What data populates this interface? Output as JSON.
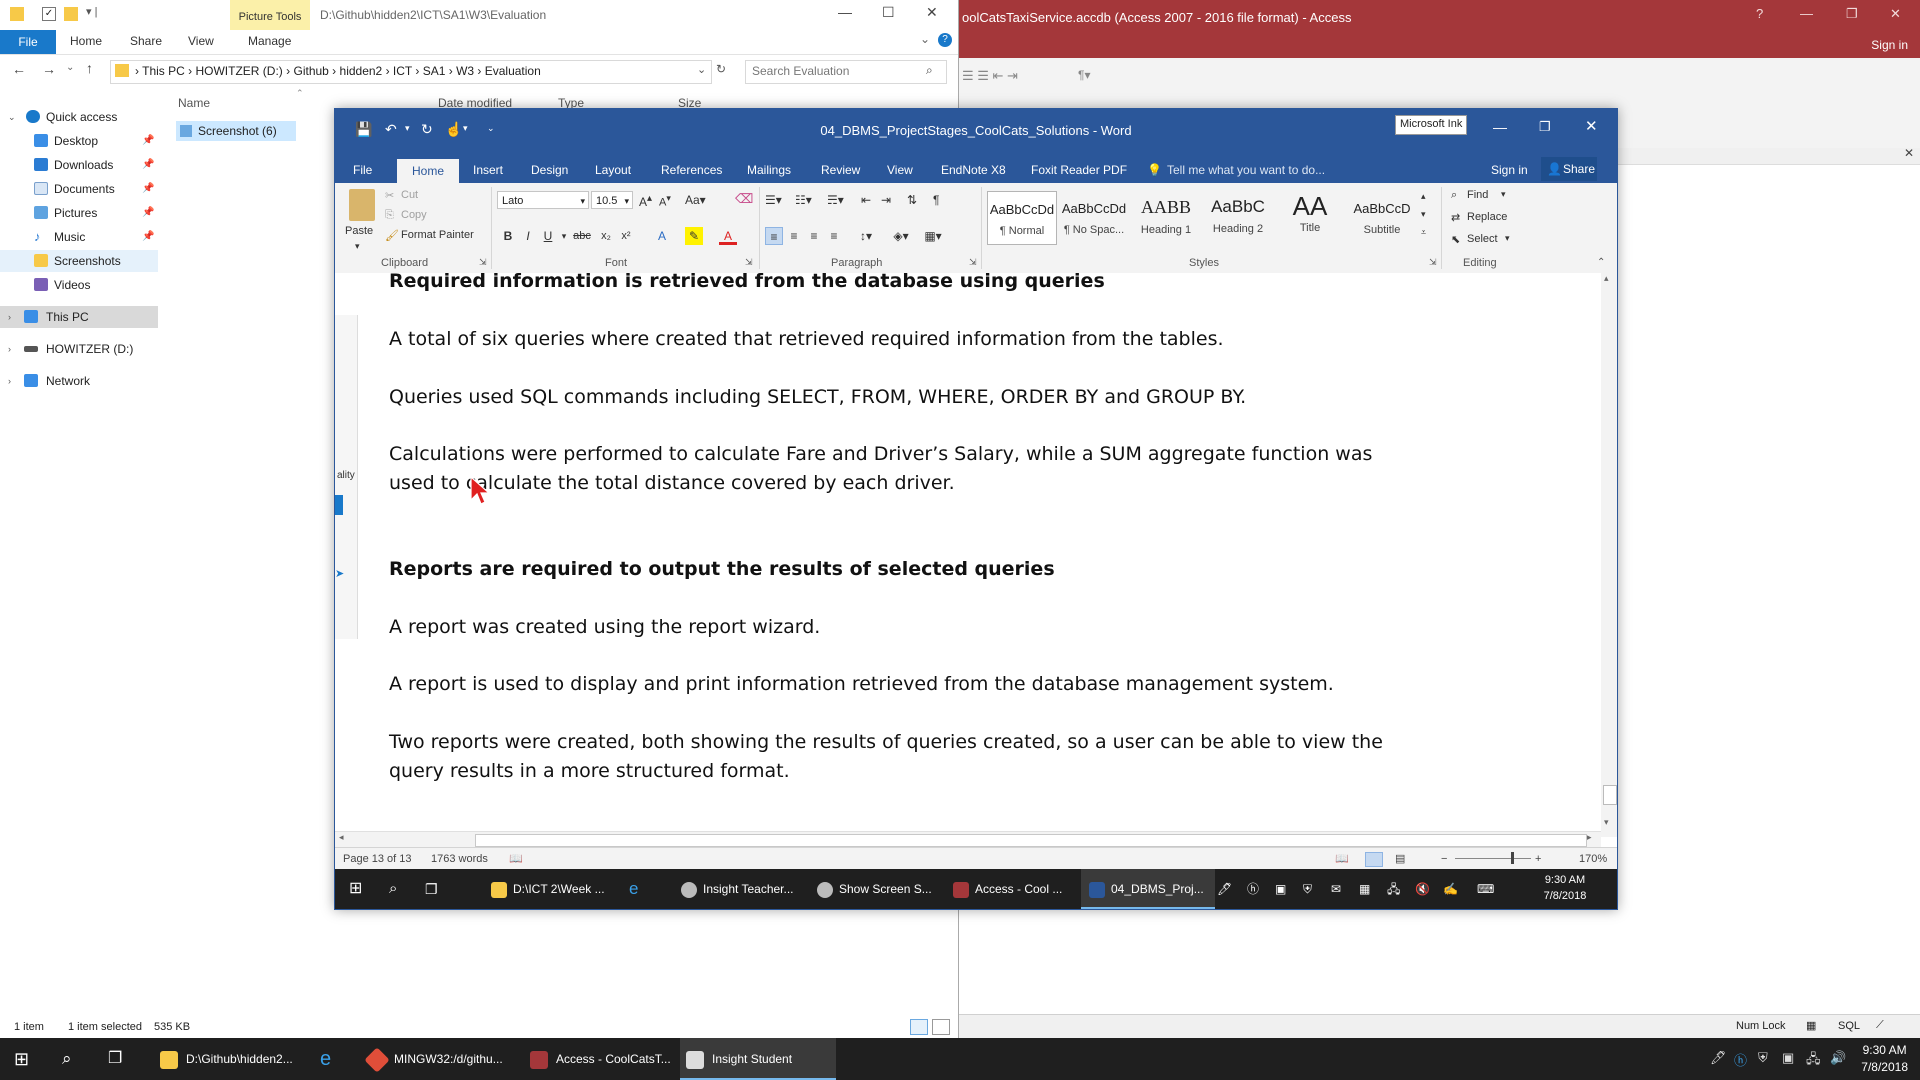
{
  "access": {
    "title": "oolCatsTaxiService.accdb (Access 2007 - 2016 file format) - Access",
    "sign_in": "Sign in",
    "status_numlock": "Num Lock",
    "status_sql": "SQL",
    "help": "?"
  },
  "explorer": {
    "picture_tools": "Picture Tools",
    "path_title": "D:\\Github\\hidden2\\ICT\\SA1\\W3\\Evaluation",
    "tabs": {
      "file": "File",
      "home": "Home",
      "share": "Share",
      "view": "View",
      "manage": "Manage"
    },
    "breadcrumb": [
      "This PC",
      "HOWITZER (D:)",
      "Github",
      "hidden2",
      "ICT",
      "SA1",
      "W3",
      "Evaluation"
    ],
    "search_placeholder": "Search Evaluation",
    "columns": {
      "name": "Name",
      "date": "Date modified",
      "type": "Type",
      "size": "Size"
    },
    "nav": {
      "quick_access": "Quick access",
      "desktop": "Desktop",
      "downloads": "Downloads",
      "documents": "Documents",
      "pictures": "Pictures",
      "music": "Music",
      "screenshots": "Screenshots",
      "videos": "Videos",
      "this_pc": "This PC",
      "howitzer": "HOWITZER (D:)",
      "network": "Network"
    },
    "file_row": "Screenshot (6)",
    "status": {
      "count": "1 item",
      "selected": "1 item selected",
      "size": "535 KB"
    }
  },
  "word": {
    "title": "04_DBMS_ProjectStages_CoolCats_Solutions - Word",
    "ink_tooltip": "Microsoft Ink",
    "tabs": {
      "file": "File",
      "home": "Home",
      "insert": "Insert",
      "design": "Design",
      "layout": "Layout",
      "references": "References",
      "mailings": "Mailings",
      "review": "Review",
      "view": "View",
      "endnote": "EndNote X8",
      "foxit": "Foxit Reader PDF",
      "tell_me": "Tell me what you want to do...",
      "sign_in": "Sign in",
      "share": "Share"
    },
    "ribbon": {
      "paste": "Paste",
      "cut": "Cut",
      "copy": "Copy",
      "format_painter": "Format Painter",
      "font_name": "Lato",
      "font_size": "10.5",
      "clipboard": "Clipboard",
      "font": "Font",
      "paragraph": "Paragraph",
      "styles": "Styles",
      "editing": "Editing",
      "find": "Find",
      "replace": "Replace",
      "select": "Select",
      "style_items": [
        {
          "preview": "AaBbCcDd",
          "name": "¶ Normal"
        },
        {
          "preview": "AaBbCcDd",
          "name": "¶ No Spac..."
        },
        {
          "preview": "AABB",
          "name": "Heading 1"
        },
        {
          "preview": "AaBbC",
          "name": "Heading 2"
        },
        {
          "preview": "AA",
          "name": "Title"
        },
        {
          "preview": "AaBbCcD",
          "name": "Subtitle"
        }
      ]
    },
    "document": {
      "p1": "Required information is retrieved from the database using queries",
      "p2": "A total of six queries where created that retrieved required information from the tables.",
      "p3": "Queries used SQL commands including SELECT, FROM, WHERE, ORDER BY and GROUP BY.",
      "p4": "Calculations were performed to calculate Fare and Driver’s Salary, while a SUM aggregate function was used to calculate the total distance covered by each driver.",
      "p5": "Reports are required to output the results of selected queries",
      "p6": "A report was created using the report wizard.",
      "p7": "A report is used to display and print information retrieved from the database management system.",
      "p8": "Two reports were created, both showing the results of queries created, so a user can be able to view the query results in a more structured format."
    },
    "left_clip_text": "ality",
    "status": {
      "page": "Page 13 of 13",
      "words": "1763 words",
      "zoom": "170%"
    },
    "inner_taskbar": {
      "items": [
        "D:\\ICT 2\\Week ...",
        "Insight Teacher...",
        "Show Screen S...",
        "Access - Cool ...",
        "04_DBMS_Proj..."
      ],
      "time": "9:30 AM",
      "date": "7/8/2018"
    }
  },
  "taskbar": {
    "items": [
      "D:\\Github\\hidden2...",
      "MINGW32:/d/githu...",
      "Access - CoolCatsT...",
      "Insight Student"
    ],
    "time": "9:30 AM",
    "date": "7/8/2018"
  }
}
